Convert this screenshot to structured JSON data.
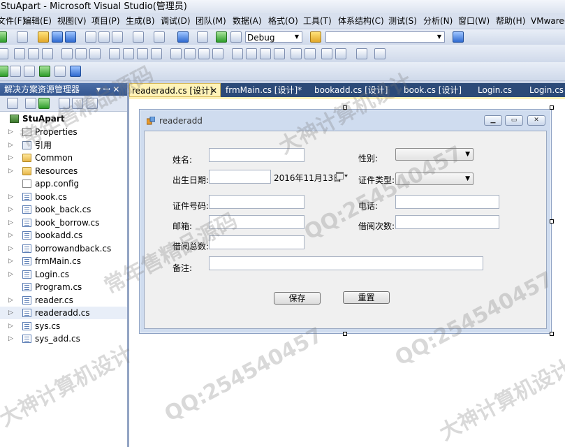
{
  "window": {
    "title": "StuApart - Microsoft Visual Studio(管理员)"
  },
  "menu": [
    "文件(F)",
    "编辑(E)",
    "视图(V)",
    "项目(P)",
    "生成(B)",
    "调试(D)",
    "团队(M)",
    "数据(A)",
    "格式(O)",
    "工具(T)",
    "体系结构(C)",
    "测试(S)",
    "分析(N)",
    "窗口(W)",
    "帮助(H)",
    "VMware(R)"
  ],
  "toolbar": {
    "config": "Debug",
    "platform": ""
  },
  "solution_explorer": {
    "title": "解决方案资源管理器",
    "pin": "▾ ꟷ ✕",
    "project": "StuApart",
    "items": [
      {
        "label": "Properties",
        "icon": "properties-icon"
      },
      {
        "label": "引用",
        "icon": "references-icon"
      },
      {
        "label": "Common",
        "icon": "folder-icon"
      },
      {
        "label": "Resources",
        "icon": "folder-icon"
      },
      {
        "label": "app.config",
        "icon": "config-file-icon"
      },
      {
        "label": "book.cs",
        "icon": "form-file-icon"
      },
      {
        "label": "book_back.cs",
        "icon": "form-file-icon"
      },
      {
        "label": "book_borrow.cs",
        "icon": "form-file-icon"
      },
      {
        "label": "bookadd.cs",
        "icon": "form-file-icon"
      },
      {
        "label": "borrowandback.cs",
        "icon": "form-file-icon"
      },
      {
        "label": "frmMain.cs",
        "icon": "form-file-icon"
      },
      {
        "label": "Login.cs",
        "icon": "form-file-icon"
      },
      {
        "label": "Program.cs",
        "icon": "cs-file-icon"
      },
      {
        "label": "reader.cs",
        "icon": "form-file-icon"
      },
      {
        "label": "readeradd.cs",
        "icon": "form-file-icon"
      },
      {
        "label": "sys.cs",
        "icon": "form-file-icon"
      },
      {
        "label": "sys_add.cs",
        "icon": "form-file-icon"
      }
    ]
  },
  "tabs": [
    {
      "label": "readeradd.cs [设计]",
      "close": "✕"
    },
    {
      "label": "frmMain.cs [设计]*"
    },
    {
      "label": "bookadd.cs [设计]"
    },
    {
      "label": "book.cs [设计]"
    },
    {
      "label": "Login.cs"
    },
    {
      "label": "Login.cs"
    }
  ],
  "form": {
    "title": "readeradd",
    "labels": {
      "name": "姓名:",
      "gender": "性别:",
      "birth": "出生日期:",
      "id_type": "证件类型:",
      "id_no": "证件号码:",
      "phone": "电话:",
      "email": "邮箱:",
      "borrow_times": "借阅次数:",
      "borrow_total": "借阅总数:",
      "remark": "备注:"
    },
    "birth_date": "2016年11月13日",
    "buttons": {
      "save": "保存",
      "reset": "重置"
    }
  },
  "watermarks": [
    "QQ:254540457",
    "常年售精品源码",
    "大神计算机设计"
  ],
  "colors": {
    "tab_bar": "#2c4a78",
    "active_tab": "#fff3b8",
    "pane_header": "#3b5c95"
  }
}
